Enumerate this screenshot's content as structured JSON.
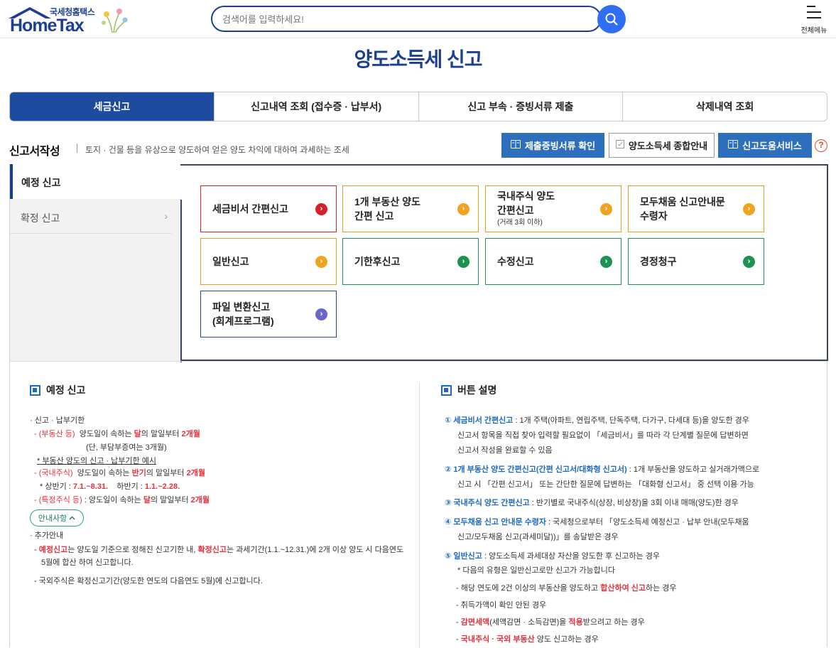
{
  "header": {
    "logo_small": "국세청홈택스",
    "logo_big": "HomeTax",
    "search_placeholder": "검색어를 입력하세요!",
    "menu_label": "전체메뉴"
  },
  "page_title": "양도소득세 신고",
  "tabs": [
    {
      "label": "세금신고"
    },
    {
      "label": "신고내역 조회 (접수증 · 납부서)"
    },
    {
      "label": "신고 부속 · 증빙서류 제출"
    },
    {
      "label": "삭제내역 조회"
    }
  ],
  "section": {
    "title": "신고서작성",
    "desc": "토지 · 건물 등을 유상으로 양도하여 얻은 양도 차익에 대하여 과세하는 조세",
    "btn_docs": "제출증빙서류 확인",
    "btn_guide": "양도소득세 종합안내",
    "btn_help": "신고도움서비스",
    "help_mark": "?"
  },
  "leftnav": {
    "active": "예정 신고",
    "item": "확정 신고",
    "arrow": "›"
  },
  "cards": [
    {
      "l1": "세금비서 간편신고",
      "l2": "",
      "sub": "",
      "dot": "›"
    },
    {
      "l1": "1개 부동산 양도",
      "l2": "간편 신고",
      "sub": "",
      "dot": "›"
    },
    {
      "l1": "국내주식 양도",
      "l2": "간편신고",
      "sub": "(거래 3회 이하)",
      "dot": "›"
    },
    {
      "l1": "모두채움 신고안내문",
      "l2": "수령자",
      "sub": "",
      "dot": "›"
    },
    {
      "l1": "일반신고",
      "l2": "",
      "sub": "",
      "dot": "›"
    },
    {
      "l1": "기한후신고",
      "l2": "",
      "sub": "",
      "dot": "›"
    },
    {
      "l1": "수정신고",
      "l2": "",
      "sub": "",
      "dot": "›"
    },
    {
      "l1": "경정청구",
      "l2": "",
      "sub": "",
      "dot": "›"
    },
    {
      "l1": "파일 변환신고",
      "l2": "(회계프로그램)",
      "sub": "",
      "dot": "›"
    }
  ],
  "left_info": {
    "title": "예정 신고",
    "l1": "· 신고 · 납부기한",
    "l2a": "- (부동산  등)",
    "l2b": "양도일이 속하는 ",
    "l2c": "달",
    "l2d": "의 말일부터 ",
    "l2e": "2개월",
    "l3": "(단, 부담부증여는 3개월)",
    "l4": "* 부동산 양도의 신고 · 납부기한 예시",
    "l5a": "- (국내주식)",
    "l5b": "양도일이 속하는 ",
    "l5c": "반기",
    "l5d": "의 말일부터 ",
    "l5e": "2개월",
    "l6a": "* 상반기 : ",
    "l6b": "7.1.~8.31.",
    "l6c": "하반기 : ",
    "l6d": "1.1.~2.28.",
    "l7a": "- (특정주식 등)",
    "l7b": " : 양도일이 속하는 ",
    "l7c": "달",
    "l7d": "의 말일부터 ",
    "l7e": "2개월",
    "guide_btn": "안내사항",
    "l8": "· 추가안내",
    "l9a": "- ",
    "l9b": "예정신고",
    "l9c": "는 양도일 기준으로 정해진 신고기한 내, ",
    "l9d": "확정신고",
    "l9e": "는 과세기간(1.1.~12.31.)에 2개 이상 양도 시 다음연도",
    "l10": "5월에 합산 하여 신고합니다.",
    "l11": "- 국외주식은 확정신고기간(양도한 연도의 다음연도 5월)에 신고합니다."
  },
  "right_info": {
    "title": "버튼 설명",
    "r1a": "① ",
    "r1b": "세금비서 간편신고",
    "r1c": " : 1개 주택(아파트, 연립주택, 단독주택, 다가구, 다세대 등)을 양도한 경우",
    "r1d": "신고서 항목을 직접 찾아 입력할 필요없이 「세금비서」를 따라 각 단계별 질문에 답변하면",
    "r1e": "신고서 작성을 완료할 수 있음",
    "r2a": "② ",
    "r2b": "1개 부동산 양도 간편신고(간편 신고서/대화형 신고서)",
    "r2c": " : 1개 부동산을 양도하고 실거래가액으로",
    "r2d": "신고 시 「간편 신고서」 또는 간단한 질문에 답변하는 「대화형 신고서」 중 선택 이용 가능",
    "r3a": "③ ",
    "r3b": "국내주식 양도 간편신고",
    "r3c": " : 반기별로 국내주식(상장, 비상장)을 3회 이내 매매(양도)한 경우",
    "r4a": "④ ",
    "r4b": "모두채움 신고 안내문 수령자",
    "r4c": " : 국세청으로부터 「양도소득세 예정신고 · 납부 안내(모두채움",
    "r4d": "신고/모두채움 신고(과세미달))」를 송달받은 경우",
    "r5a": "⑤ ",
    "r5b": "일반신고",
    "r5c": " : 양도소득세 과세대상 자산을 양도한 후 신고하는 경우",
    "r6": "* 다음의 유형은 일반신고로만 신고가 가능합니다",
    "r7a": "- 해당 연도에 2건 이상의 부동산을 양도하고 ",
    "r7b": "합산하여 신고",
    "r7c": "하는 경우",
    "r8": "- 취득가액이 확인 안된 경우",
    "r9a": "- ",
    "r9b": "감면세액",
    "r9c": "(세액감면 · 소득감면)을 ",
    "r9d": "적용",
    "r9e": "받으려고 하는 경우",
    "r10a": "- ",
    "r10b": "국내주식 · 국외 부동산",
    "r10c": " 양도 신고하는 경우"
  }
}
